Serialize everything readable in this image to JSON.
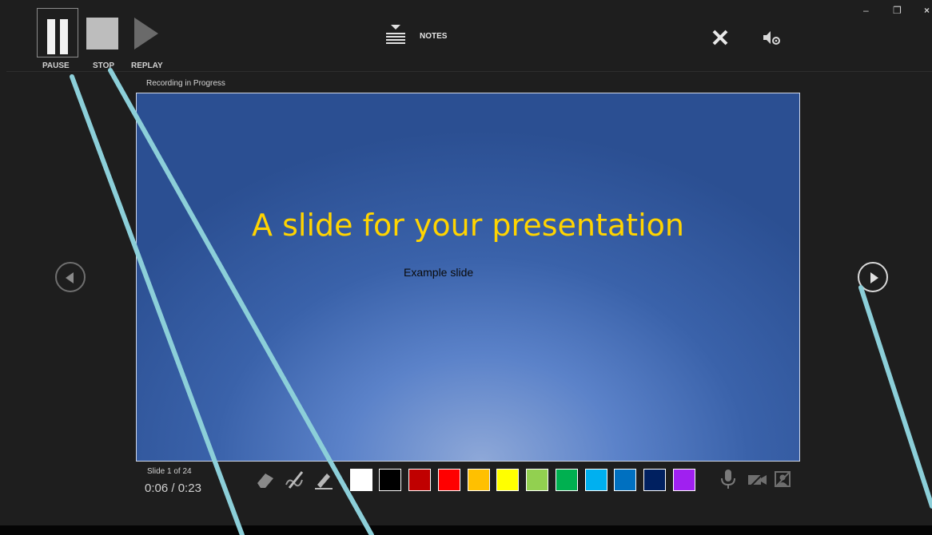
{
  "toolbar": {
    "pause_label": "PAUSE",
    "stop_label": "STOP",
    "replay_label": "REPLAY",
    "notes_label": "NOTES"
  },
  "status": {
    "recording_label": "Recording in Progress",
    "slide_counter": "Slide 1 of 24",
    "time_elapsed": "0:06",
    "time_separator": "/",
    "time_total": "0:23"
  },
  "slide": {
    "title": "A slide for your presentation",
    "subtitle": "Example slide"
  },
  "colors": {
    "background": "#1e1e1e",
    "title_text": "#ffd400",
    "annotation_lines": "#8ccfd9",
    "swatches": [
      "#ffffff",
      "#000000",
      "#c00000",
      "#ff0000",
      "#ffc000",
      "#ffff00",
      "#92d050",
      "#00b050",
      "#00b0f0",
      "#0070c0",
      "#002060",
      "#a020f0"
    ]
  },
  "icons": {
    "pause": "pause-icon",
    "stop": "stop-icon",
    "replay": "replay-icon",
    "notes": "notes-icon",
    "close": "close-icon",
    "settings": "audio-settings-icon",
    "prev": "previous-slide-icon",
    "next": "next-slide-icon",
    "eraser": "eraser-icon",
    "pen": "pen-icon",
    "highlighter": "highlighter-icon",
    "microphone": "microphone-icon",
    "camera": "camera-icon",
    "preview": "camera-preview-icon"
  }
}
